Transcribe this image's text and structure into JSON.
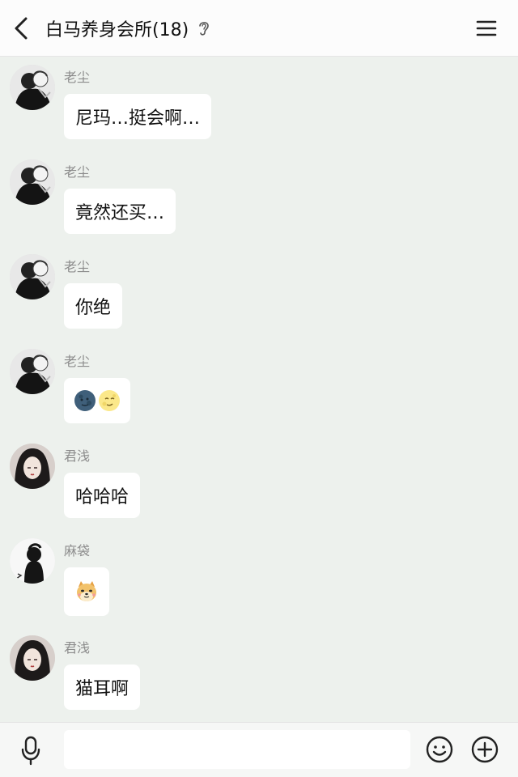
{
  "header": {
    "title": "白马养身会所(18)",
    "back_icon": "chevron-left-icon",
    "status_icon": "ear-icon",
    "menu_icon": "hamburger-menu-icon"
  },
  "messages": [
    {
      "sender": "老尘",
      "text": "尼玛…挺会啊…",
      "avatar": "laochen"
    },
    {
      "sender": "老尘",
      "text": "竟然还买…",
      "avatar": "laochen"
    },
    {
      "sender": "老尘",
      "text": "你绝",
      "avatar": "laochen"
    },
    {
      "sender": "老尘",
      "emojis": [
        "new-moon-face-emoji",
        "full-moon-face-emoji"
      ],
      "avatar": "laochen"
    },
    {
      "sender": "君浅",
      "text": "哈哈哈",
      "avatar": "junqian"
    },
    {
      "sender": "麻袋",
      "emojis": [
        "cheems-dog-sticker"
      ],
      "avatar": "madai"
    },
    {
      "sender": "君浅",
      "text": "猫耳啊",
      "avatar": "junqian"
    }
  ],
  "input_bar": {
    "placeholder": "",
    "icons": [
      "microphone-icon",
      "smiley-icon",
      "plus-circle-icon"
    ]
  },
  "colors": {
    "chat_background": "#edf1ed",
    "bubble": "#ffffff",
    "sender_name": "#8c8c8c"
  }
}
